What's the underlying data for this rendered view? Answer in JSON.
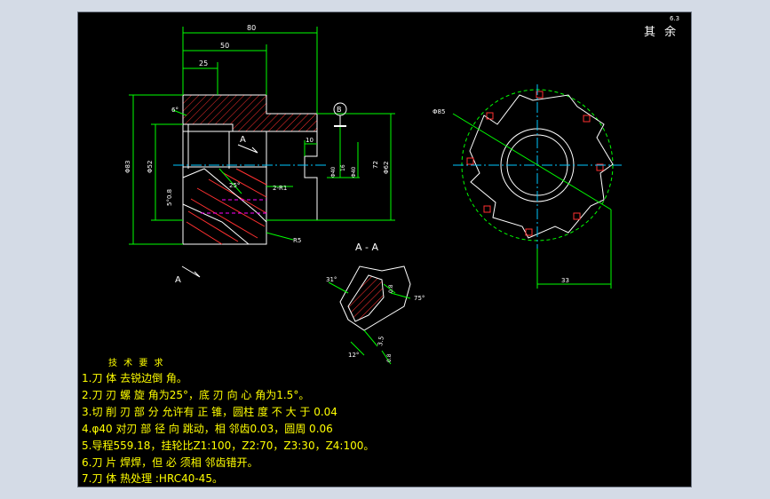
{
  "drawing": {
    "dimensions": {
      "len_80": "80",
      "len_50": "50",
      "len_25": "25",
      "len_10": "10",
      "len_33": "33",
      "len_3_5": "3.5",
      "dia_83": "Φ83",
      "dia_52": "Φ52",
      "dia_62": "Φ62",
      "dia_85": "Φ85",
      "width_72": "72",
      "angle_6": "6°",
      "angle_25": "25°",
      "angle_31": "31°",
      "angle_75": "75°",
      "angle_12": "12°",
      "radius_r1": "2-R1",
      "radius_r5": "R5",
      "tol_0_8": "0.8",
      "tol_0_8b": "0.8",
      "tol_5": "5°0.8",
      "tol_bore": "Φ40",
      "fit_a": "16",
      "fit_b": "Φ40"
    },
    "section_marks": {
      "view_a_top": "A",
      "view_a_bottom": "A",
      "section_title": "A - A",
      "datum": "B"
    },
    "roughness_label": "其 余",
    "roughness_value": "6.3"
  },
  "notes": {
    "title": "技 术 要 求",
    "items": [
      "1.刀 体 去锐边倒 角。",
      "2.刀 刃 螺 旋 角为25°，底 刃 向 心 角为1.5°。",
      "3.切 削 刃 部 分 允许有 正 锥，圆柱 度 不 大 于 0.04",
      "4.φ40 对刃 部 径 向 跳动，相 邻齿0.03，圆周 0.06",
      "5.导程559.18，挂轮比Z1:100，Z2:70，Z3:30，Z4:100。",
      "6.刀 片 焊焊，但 必 须相 邻齿错开。",
      "7.刀 体 热处理 :HRC40-45。"
    ]
  },
  "colors": {
    "background": "#000000",
    "outline": "#ffffff",
    "dimension": "#00ff00",
    "hatch": "#ff3030",
    "centerline": "#00c8ff",
    "hidden": "#ff00ff",
    "text": "#ffff00"
  }
}
